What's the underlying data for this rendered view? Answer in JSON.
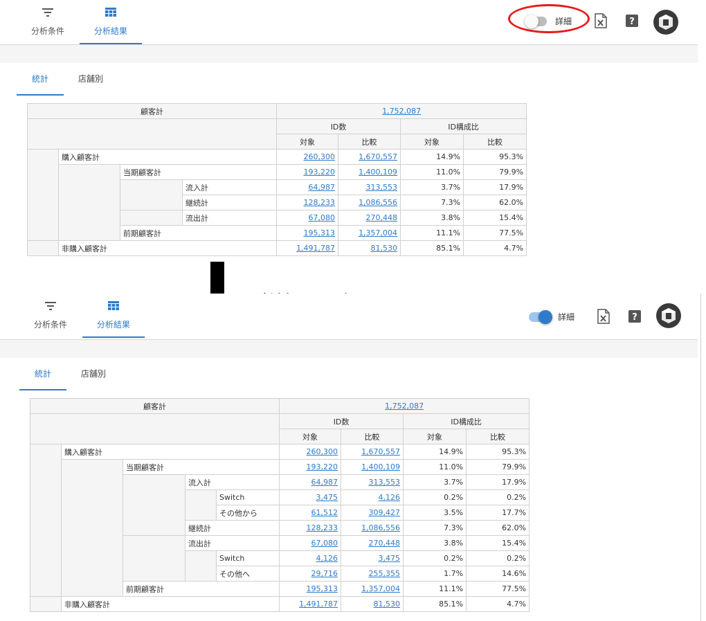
{
  "nav": {
    "conditions_label": "分析条件",
    "results_label": "分析結果"
  },
  "detail_toggle": {
    "label": "詳細",
    "before_state": "off",
    "after_state": "on"
  },
  "subtabs": {
    "stats_label": "統計",
    "store_label": "店舗別"
  },
  "table": {
    "customer_total_label": "顧客計",
    "customer_total_value": "1,752,087",
    "id_count_header": "ID数",
    "id_ratio_header": "ID構成比",
    "target_label": "対象",
    "compare_label": "比較"
  },
  "before_rows": [
    {
      "label": "購入顧客計",
      "target": "260,300",
      "compare": "1,670,557",
      "t_pct": "14.9%",
      "c_pct": "95.3%"
    },
    {
      "label": "当期顧客計",
      "target": "193,220",
      "compare": "1,400,109",
      "t_pct": "11.0%",
      "c_pct": "79.9%"
    },
    {
      "label": "流入計",
      "target": "64,987",
      "compare": "313,553",
      "t_pct": "3.7%",
      "c_pct": "17.9%"
    },
    {
      "label": "継続計",
      "target": "128,233",
      "compare": "1,086,556",
      "t_pct": "7.3%",
      "c_pct": "62.0%"
    },
    {
      "label": "流出計",
      "target": "67,080",
      "compare": "270,448",
      "t_pct": "3.8%",
      "c_pct": "15.4%"
    },
    {
      "label": "前期顧客計",
      "target": "195,313",
      "compare": "1,357,004",
      "t_pct": "11.1%",
      "c_pct": "77.5%"
    },
    {
      "label": "非購入顧客計",
      "target": "1,491,787",
      "compare": "81,530",
      "t_pct": "85.1%",
      "c_pct": "4.7%"
    }
  ],
  "after_rows": [
    {
      "label": "購入顧客計",
      "target": "260,300",
      "compare": "1,670,557",
      "t_pct": "14.9%",
      "c_pct": "95.3%"
    },
    {
      "label": "当期顧客計",
      "target": "193,220",
      "compare": "1,400,109",
      "t_pct": "11.0%",
      "c_pct": "79.9%"
    },
    {
      "label": "流入計",
      "target": "64,987",
      "compare": "313,553",
      "t_pct": "3.7%",
      "c_pct": "17.9%"
    },
    {
      "label": "Switch",
      "target": "3,475",
      "compare": "4,126",
      "t_pct": "0.2%",
      "c_pct": "0.2%"
    },
    {
      "label": "その他から",
      "target": "61,512",
      "compare": "309,427",
      "t_pct": "3.5%",
      "c_pct": "17.7%"
    },
    {
      "label": "継続計",
      "target": "128,233",
      "compare": "1,086,556",
      "t_pct": "7.3%",
      "c_pct": "62.0%"
    },
    {
      "label": "流出計",
      "target": "67,080",
      "compare": "270,448",
      "t_pct": "3.8%",
      "c_pct": "15.4%"
    },
    {
      "label": "Switch",
      "target": "4,126",
      "compare": "3,475",
      "t_pct": "0.2%",
      "c_pct": "0.2%"
    },
    {
      "label": "その他へ",
      "target": "29,716",
      "compare": "255,355",
      "t_pct": "1.7%",
      "c_pct": "14.6%"
    },
    {
      "label": "前期顧客計",
      "target": "195,313",
      "compare": "1,357,004",
      "t_pct": "11.1%",
      "c_pct": "77.5%"
    },
    {
      "label": "非購入顧客計",
      "target": "1,491,787",
      "compare": "81,530",
      "t_pct": "85.1%",
      "c_pct": "4.7%"
    }
  ],
  "annotation": "詳細トグル ON",
  "icons": {
    "filter": "filter-icon",
    "table": "table-icon",
    "excel": "excel-export-icon",
    "help": "help-icon",
    "avatar": "avatar-icon"
  },
  "colors": {
    "accent": "#2f7ac9",
    "highlight": "#e51c1c"
  }
}
